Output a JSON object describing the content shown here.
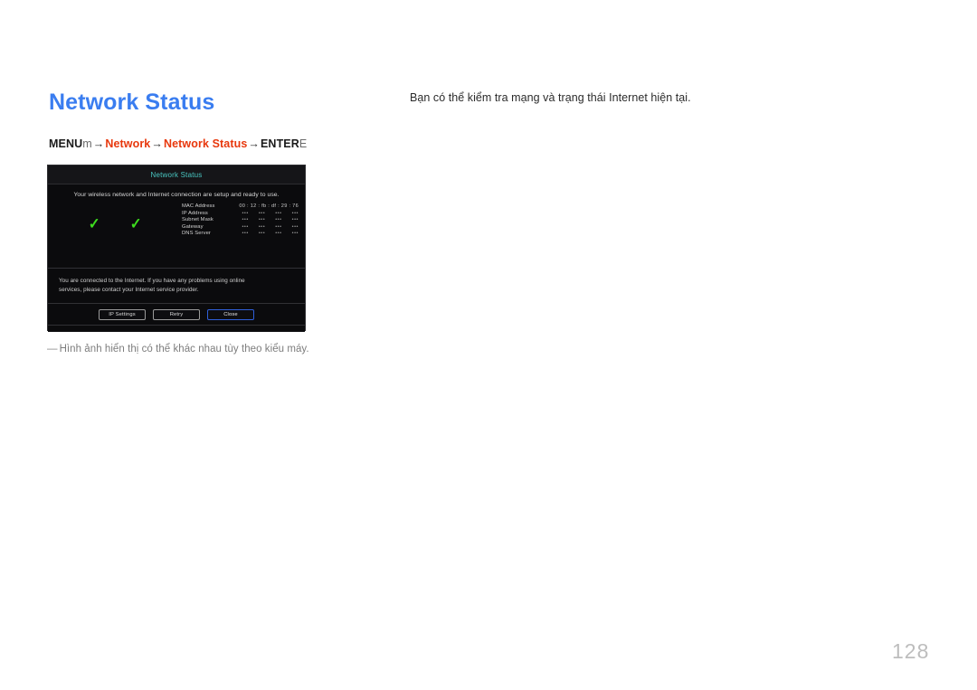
{
  "page": {
    "title": "Network Status",
    "number": "128"
  },
  "breadcrumb": {
    "menu_label": "MENU",
    "menu_glyph": "m",
    "arrow": "→",
    "step1": "Network",
    "step2": "Network Status",
    "enter_label": "ENTER",
    "enter_glyph": "E"
  },
  "description": "Bạn có thể kiểm tra mạng và trạng thái Internet hiện tại.",
  "footnote": {
    "dash": "―",
    "text": "Hình ảnh hiển thị có thể khác nhau tùy theo kiểu máy."
  },
  "screen": {
    "header_title": "Network Status",
    "status_line": "Your wireless network and Internet connection are setup and ready to use.",
    "check_1": "✓",
    "check_2": "✓",
    "network_rows": [
      {
        "label": "MAC Address",
        "value": "00 : 12 : fb : df : 29 : 76",
        "masked": false
      },
      {
        "label": "IP Address",
        "value": "",
        "masked": true
      },
      {
        "label": "Subnet Mask",
        "value": "",
        "masked": true
      },
      {
        "label": "Gateway",
        "value": "",
        "masked": true
      },
      {
        "label": "DNS Server",
        "value": "",
        "masked": true
      }
    ],
    "mask_token": "•••",
    "message_line1": "You are connected to the Internet. If you have any problems using online",
    "message_line2": "services, please contact your Internet service provider.",
    "buttons": [
      {
        "label": "IP Settings",
        "focused": false
      },
      {
        "label": "Retry",
        "focused": false
      },
      {
        "label": "Close",
        "focused": true
      }
    ]
  },
  "colors": {
    "title_blue": "#3a7df0",
    "accent_red": "#e8380d",
    "screen_title_teal": "#49c7c2",
    "check_green": "#3ddb1e",
    "focus_blue": "#2f5fd8",
    "page_number_gray": "#bdbdbd"
  }
}
